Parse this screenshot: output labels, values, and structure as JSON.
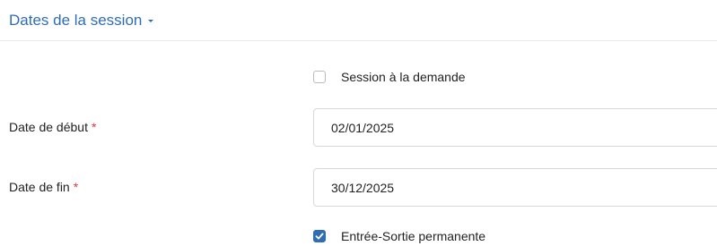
{
  "section": {
    "title": "Dates de la session",
    "toggle_icon": "caret-down-icon"
  },
  "on_demand": {
    "label": "Session à la demande",
    "checked": false
  },
  "start_date": {
    "label": "Date de début",
    "required_marker": "*",
    "value": "02/01/2025"
  },
  "end_date": {
    "label": "Date de fin",
    "required_marker": "*",
    "value": "30/12/2025"
  },
  "permanent_entry": {
    "label": "Entrée-Sortie permanente",
    "checked": true
  },
  "colors": {
    "accent": "#2f6db5",
    "required": "#e03a3a"
  }
}
